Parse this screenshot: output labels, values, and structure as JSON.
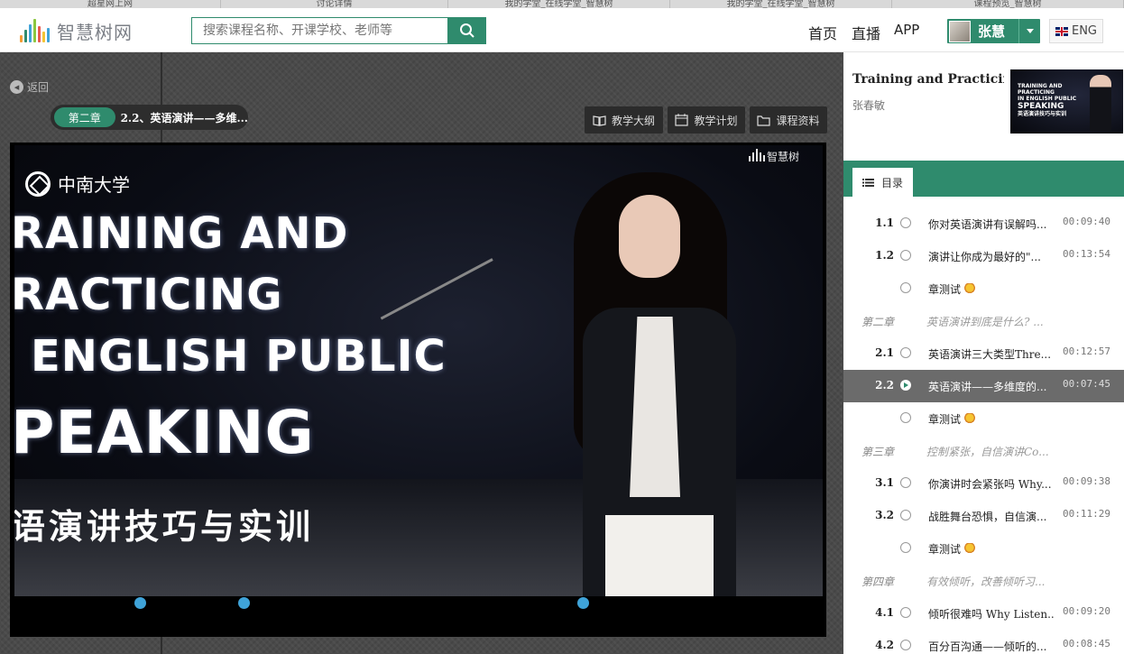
{
  "browser_tabs": [
    "超星网上网",
    "讨论详情",
    "我的学堂_在线学堂_智慧树",
    "我的学堂_在线学堂_智慧树",
    "课程预览_智慧树"
  ],
  "header": {
    "logo_text": "智慧树网",
    "search_placeholder": "搜索课程名称、开课学校、老师等",
    "nav": [
      "首页",
      "直播",
      "APP"
    ],
    "user_name": "张慧",
    "lang": "ENG",
    "accent": "#2f8b6d"
  },
  "player": {
    "back_label": "返回",
    "chapter_tag": "第二章",
    "chapter_title": "2.2、英语演讲——多维...",
    "tools": [
      "教学大纲",
      "教学计划",
      "课程资料"
    ],
    "video": {
      "school": "中南大学",
      "brand": "智慧树",
      "title_lines": [
        "RAINING AND",
        "RACTICING",
        "ENGLISH PUBLIC",
        "PEAKING"
      ],
      "subtitle": "语演讲技巧与实训"
    },
    "progress_marker_count": 3
  },
  "course": {
    "title": "Training and Practicing i...",
    "teacher": "张春敏",
    "thumb_lines": [
      "TRAINING AND",
      "PRACTICING",
      "IN ENGLISH PUBLIC",
      "SPEAKING",
      "英语演讲技巧与实训"
    ]
  },
  "catalog": {
    "tab_label": "目录",
    "items": [
      {
        "type": "lesson",
        "num": "1.1",
        "name": "你对英语演讲有误解吗...",
        "dur": "00:09:40"
      },
      {
        "type": "lesson",
        "num": "1.2",
        "name": "演讲让你成为最好的\"...",
        "dur": "00:13:54"
      },
      {
        "type": "test",
        "num": "",
        "name": "章测试",
        "dur": ""
      },
      {
        "type": "chapter",
        "num": "第二章",
        "name": "英语演讲到底是什么? ...",
        "dur": ""
      },
      {
        "type": "lesson",
        "num": "2.1",
        "name": "英语演讲三大类型Thre...",
        "dur": "00:12:57"
      },
      {
        "type": "active",
        "num": "2.2",
        "name": "英语演讲——多维度的...",
        "dur": "00:07:45"
      },
      {
        "type": "test",
        "num": "",
        "name": "章测试",
        "dur": ""
      },
      {
        "type": "chapter",
        "num": "第三章",
        "name": "控制紧张，自信演讲Co...",
        "dur": ""
      },
      {
        "type": "lesson",
        "num": "3.1",
        "name": "你演讲时会紧张吗 Why...",
        "dur": "00:09:38"
      },
      {
        "type": "lesson",
        "num": "3.2",
        "name": "战胜舞台恐惧，自信演...",
        "dur": "00:11:29"
      },
      {
        "type": "test",
        "num": "",
        "name": "章测试",
        "dur": ""
      },
      {
        "type": "chapter",
        "num": "第四章",
        "name": "有效倾听，改善倾听习...",
        "dur": ""
      },
      {
        "type": "lesson",
        "num": "4.1",
        "name": "倾听很难吗 Why Listen...",
        "dur": "00:09:20"
      },
      {
        "type": "lesson",
        "num": "4.2",
        "name": "百分百沟通——倾听的...",
        "dur": "00:08:45"
      }
    ]
  }
}
